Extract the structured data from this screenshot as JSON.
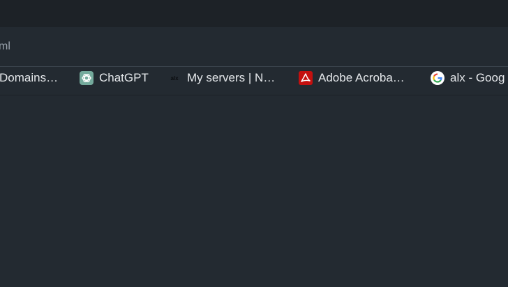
{
  "address_bar": {
    "url_fragment": "ml"
  },
  "bookmarks": [
    {
      "label": "Domains…",
      "icon": "bookmark-favicon"
    },
    {
      "label": "ChatGPT",
      "icon": "chatgpt-icon",
      "icon_color": "#74aa9c"
    },
    {
      "label": "My servers | N…",
      "icon": "alx-icon"
    },
    {
      "label": "Adobe Acroba…",
      "icon": "adobe-acrobat-icon",
      "icon_color": "#c4100f"
    },
    {
      "label": "alx - Goog",
      "icon": "google-icon"
    }
  ]
}
